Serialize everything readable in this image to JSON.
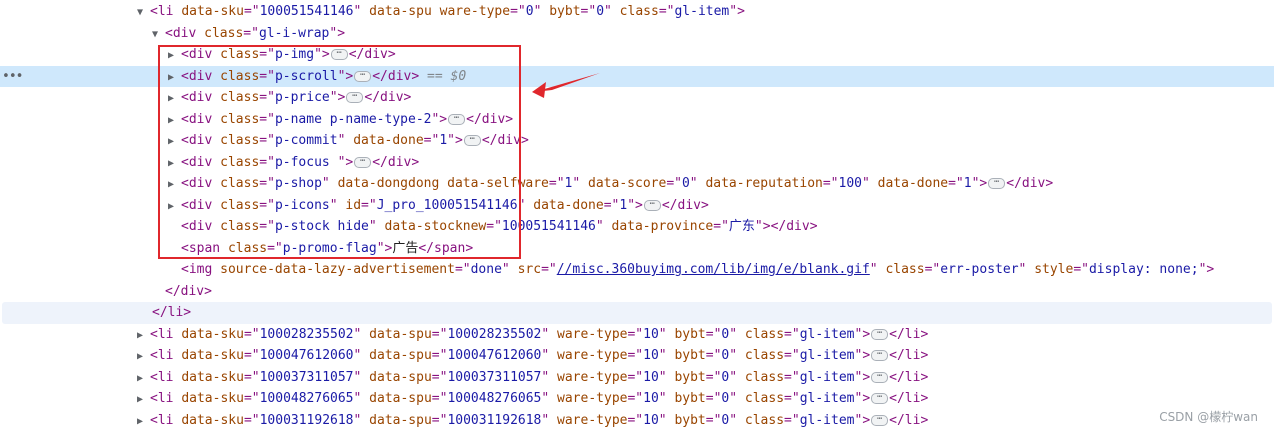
{
  "selected_marker": "== $0",
  "watermark": "CSDN @檬柠wan",
  "rows": [
    {
      "ind": 137,
      "tw": "▼",
      "p": [
        [
          "tag",
          "<li "
        ],
        [
          "an",
          "data-sku"
        ],
        [
          "tag",
          "=\""
        ],
        [
          "av",
          "100051541146"
        ],
        [
          "tag",
          "\" "
        ],
        [
          "an",
          "data-spu"
        ],
        [
          "tag",
          " "
        ],
        [
          "an",
          "ware-type"
        ],
        [
          "tag",
          "=\""
        ],
        [
          "av",
          "0"
        ],
        [
          "tag",
          "\" "
        ],
        [
          "an",
          "bybt"
        ],
        [
          "tag",
          "=\""
        ],
        [
          "av",
          "0"
        ],
        [
          "tag",
          "\" "
        ],
        [
          "an",
          "class"
        ],
        [
          "tag",
          "=\""
        ],
        [
          "av",
          "gl-item"
        ],
        [
          "tag",
          "\">"
        ]
      ]
    },
    {
      "ind": 152,
      "tw": "▼",
      "p": [
        [
          "tag",
          "<div "
        ],
        [
          "an",
          "class"
        ],
        [
          "tag",
          "=\""
        ],
        [
          "av",
          "gl-i-wrap"
        ],
        [
          "tag",
          "\">"
        ]
      ]
    },
    {
      "ind": 168,
      "tw": "▶",
      "p": [
        [
          "tag",
          "<div "
        ],
        [
          "an",
          "class"
        ],
        [
          "tag",
          "=\""
        ],
        [
          "av",
          "p-img"
        ],
        [
          "tag",
          "\">"
        ],
        [
          "ell",
          ""
        ],
        [
          "tag",
          "</div>"
        ]
      ]
    },
    {
      "ind": 168,
      "tw": "▶",
      "sel": true,
      "p": [
        [
          "tag",
          "<div "
        ],
        [
          "an",
          "class"
        ],
        [
          "tag",
          "=\""
        ],
        [
          "av",
          "p-scroll"
        ],
        [
          "tag",
          "\">"
        ],
        [
          "ell",
          ""
        ],
        [
          "tag",
          "</div>"
        ],
        [
          "dim",
          " == $0"
        ]
      ]
    },
    {
      "ind": 168,
      "tw": "▶",
      "p": [
        [
          "tag",
          "<div "
        ],
        [
          "an",
          "class"
        ],
        [
          "tag",
          "=\""
        ],
        [
          "av",
          "p-price"
        ],
        [
          "tag",
          "\">"
        ],
        [
          "ell",
          ""
        ],
        [
          "tag",
          "</div>"
        ]
      ]
    },
    {
      "ind": 168,
      "tw": "▶",
      "p": [
        [
          "tag",
          "<div "
        ],
        [
          "an",
          "class"
        ],
        [
          "tag",
          "=\""
        ],
        [
          "av",
          "p-name p-name-type-2"
        ],
        [
          "tag",
          "\">"
        ],
        [
          "ell",
          ""
        ],
        [
          "tag",
          "</div>"
        ]
      ]
    },
    {
      "ind": 168,
      "tw": "▶",
      "p": [
        [
          "tag",
          "<div "
        ],
        [
          "an",
          "class"
        ],
        [
          "tag",
          "=\""
        ],
        [
          "av",
          "p-commit"
        ],
        [
          "tag",
          "\" "
        ],
        [
          "an",
          "data-done"
        ],
        [
          "tag",
          "=\""
        ],
        [
          "av",
          "1"
        ],
        [
          "tag",
          "\">"
        ],
        [
          "ell",
          ""
        ],
        [
          "tag",
          "</div>"
        ]
      ]
    },
    {
      "ind": 168,
      "tw": "▶",
      "p": [
        [
          "tag",
          "<div "
        ],
        [
          "an",
          "class"
        ],
        [
          "tag",
          "=\""
        ],
        [
          "av",
          "p-focus  "
        ],
        [
          "tag",
          "\">"
        ],
        [
          "ell",
          ""
        ],
        [
          "tag",
          "</div>"
        ]
      ]
    },
    {
      "ind": 168,
      "tw": "▶",
      "p": [
        [
          "tag",
          "<div "
        ],
        [
          "an",
          "class"
        ],
        [
          "tag",
          "=\""
        ],
        [
          "av",
          "p-shop"
        ],
        [
          "tag",
          "\" "
        ],
        [
          "an",
          "data-dongdong"
        ],
        [
          "tag",
          " "
        ],
        [
          "an",
          "data-selfware"
        ],
        [
          "tag",
          "=\""
        ],
        [
          "av",
          "1"
        ],
        [
          "tag",
          "\" "
        ],
        [
          "an",
          "data-score"
        ],
        [
          "tag",
          "=\""
        ],
        [
          "av",
          "0"
        ],
        [
          "tag",
          "\" "
        ],
        [
          "an",
          "data-reputation"
        ],
        [
          "tag",
          "=\""
        ],
        [
          "av",
          "100"
        ],
        [
          "tag",
          "\" "
        ],
        [
          "an",
          "data-done"
        ],
        [
          "tag",
          "=\""
        ],
        [
          "av",
          "1"
        ],
        [
          "tag",
          "\">"
        ],
        [
          "ell",
          ""
        ],
        [
          "tag",
          "</div>"
        ]
      ]
    },
    {
      "ind": 168,
      "tw": "▶",
      "p": [
        [
          "tag",
          "<div "
        ],
        [
          "an",
          "class"
        ],
        [
          "tag",
          "=\""
        ],
        [
          "av",
          "p-icons"
        ],
        [
          "tag",
          "\" "
        ],
        [
          "an",
          "id"
        ],
        [
          "tag",
          "=\""
        ],
        [
          "av",
          "J_pro_100051541146"
        ],
        [
          "tag",
          "\" "
        ],
        [
          "an",
          "data-done"
        ],
        [
          "tag",
          "=\""
        ],
        [
          "av",
          "1"
        ],
        [
          "tag",
          "\">"
        ],
        [
          "ell",
          ""
        ],
        [
          "tag",
          "</div>"
        ]
      ]
    },
    {
      "ind": 168,
      "tw": "",
      "p": [
        [
          "tag",
          "<div "
        ],
        [
          "an",
          "class"
        ],
        [
          "tag",
          "=\""
        ],
        [
          "av",
          "p-stock hide"
        ],
        [
          "tag",
          "\" "
        ],
        [
          "an",
          "data-stocknew"
        ],
        [
          "tag",
          "=\""
        ],
        [
          "av",
          "100051541146"
        ],
        [
          "tag",
          "\" "
        ],
        [
          "an",
          "data-province"
        ],
        [
          "tag",
          "=\""
        ],
        [
          "av",
          "广东"
        ],
        [
          "tag",
          "\"></div>"
        ]
      ]
    },
    {
      "ind": 168,
      "tw": "",
      "p": [
        [
          "tag",
          "<span "
        ],
        [
          "an",
          "class"
        ],
        [
          "tag",
          "=\""
        ],
        [
          "av",
          "p-promo-flag"
        ],
        [
          "tag",
          "\">"
        ],
        [
          "tx",
          "广告"
        ],
        [
          "tag",
          "</span>"
        ]
      ]
    },
    {
      "ind": 168,
      "tw": "",
      "p": [
        [
          "tag",
          "<img "
        ],
        [
          "an",
          "source-data-lazy-advertisement"
        ],
        [
          "tag",
          "=\""
        ],
        [
          "av",
          "done"
        ],
        [
          "tag",
          "\" "
        ],
        [
          "an",
          "src"
        ],
        [
          "tag",
          "=\""
        ],
        [
          "link",
          "//misc.360buyimg.com/lib/img/e/blank.gif"
        ],
        [
          "tag",
          "\" "
        ],
        [
          "an",
          "class"
        ],
        [
          "tag",
          "=\""
        ],
        [
          "av",
          "err-poster"
        ],
        [
          "tag",
          "\" "
        ],
        [
          "an",
          "style"
        ],
        [
          "tag",
          "=\""
        ],
        [
          "av",
          "display: none;"
        ],
        [
          "tag",
          "\">"
        ]
      ]
    },
    {
      "ind": 152,
      "tw": "",
      "p": [
        [
          "tag",
          "</div>"
        ]
      ]
    },
    {
      "ind": 137,
      "tw": "",
      "hov": true,
      "p": [
        [
          "tag",
          "</li>"
        ]
      ]
    },
    {
      "ind": 137,
      "tw": "▶",
      "p": [
        [
          "tag",
          "<li "
        ],
        [
          "an",
          "data-sku"
        ],
        [
          "tag",
          "=\""
        ],
        [
          "av",
          "100028235502"
        ],
        [
          "tag",
          "\" "
        ],
        [
          "an",
          "data-spu"
        ],
        [
          "tag",
          "=\""
        ],
        [
          "av",
          "100028235502"
        ],
        [
          "tag",
          "\" "
        ],
        [
          "an",
          "ware-type"
        ],
        [
          "tag",
          "=\""
        ],
        [
          "av",
          "10"
        ],
        [
          "tag",
          "\" "
        ],
        [
          "an",
          "bybt"
        ],
        [
          "tag",
          "=\""
        ],
        [
          "av",
          "0"
        ],
        [
          "tag",
          "\" "
        ],
        [
          "an",
          "class"
        ],
        [
          "tag",
          "=\""
        ],
        [
          "av",
          "gl-item"
        ],
        [
          "tag",
          "\">"
        ],
        [
          "ell",
          ""
        ],
        [
          "tag",
          "</li>"
        ]
      ]
    },
    {
      "ind": 137,
      "tw": "▶",
      "p": [
        [
          "tag",
          "<li "
        ],
        [
          "an",
          "data-sku"
        ],
        [
          "tag",
          "=\""
        ],
        [
          "av",
          "100047612060"
        ],
        [
          "tag",
          "\" "
        ],
        [
          "an",
          "data-spu"
        ],
        [
          "tag",
          "=\""
        ],
        [
          "av",
          "100047612060"
        ],
        [
          "tag",
          "\" "
        ],
        [
          "an",
          "ware-type"
        ],
        [
          "tag",
          "=\""
        ],
        [
          "av",
          "10"
        ],
        [
          "tag",
          "\" "
        ],
        [
          "an",
          "bybt"
        ],
        [
          "tag",
          "=\""
        ],
        [
          "av",
          "0"
        ],
        [
          "tag",
          "\" "
        ],
        [
          "an",
          "class"
        ],
        [
          "tag",
          "=\""
        ],
        [
          "av",
          "gl-item"
        ],
        [
          "tag",
          "\">"
        ],
        [
          "ell",
          ""
        ],
        [
          "tag",
          "</li>"
        ]
      ]
    },
    {
      "ind": 137,
      "tw": "▶",
      "p": [
        [
          "tag",
          "<li "
        ],
        [
          "an",
          "data-sku"
        ],
        [
          "tag",
          "=\""
        ],
        [
          "av",
          "100037311057"
        ],
        [
          "tag",
          "\" "
        ],
        [
          "an",
          "data-spu"
        ],
        [
          "tag",
          "=\""
        ],
        [
          "av",
          "100037311057"
        ],
        [
          "tag",
          "\" "
        ],
        [
          "an",
          "ware-type"
        ],
        [
          "tag",
          "=\""
        ],
        [
          "av",
          "10"
        ],
        [
          "tag",
          "\" "
        ],
        [
          "an",
          "bybt"
        ],
        [
          "tag",
          "=\""
        ],
        [
          "av",
          "0"
        ],
        [
          "tag",
          "\" "
        ],
        [
          "an",
          "class"
        ],
        [
          "tag",
          "=\""
        ],
        [
          "av",
          "gl-item"
        ],
        [
          "tag",
          "\">"
        ],
        [
          "ell",
          ""
        ],
        [
          "tag",
          "</li>"
        ]
      ]
    },
    {
      "ind": 137,
      "tw": "▶",
      "p": [
        [
          "tag",
          "<li "
        ],
        [
          "an",
          "data-sku"
        ],
        [
          "tag",
          "=\""
        ],
        [
          "av",
          "100048276065"
        ],
        [
          "tag",
          "\" "
        ],
        [
          "an",
          "data-spu"
        ],
        [
          "tag",
          "=\""
        ],
        [
          "av",
          "100048276065"
        ],
        [
          "tag",
          "\" "
        ],
        [
          "an",
          "ware-type"
        ],
        [
          "tag",
          "=\""
        ],
        [
          "av",
          "10"
        ],
        [
          "tag",
          "\" "
        ],
        [
          "an",
          "bybt"
        ],
        [
          "tag",
          "=\""
        ],
        [
          "av",
          "0"
        ],
        [
          "tag",
          "\" "
        ],
        [
          "an",
          "class"
        ],
        [
          "tag",
          "=\""
        ],
        [
          "av",
          "gl-item"
        ],
        [
          "tag",
          "\">"
        ],
        [
          "ell",
          ""
        ],
        [
          "tag",
          "</li>"
        ]
      ]
    },
    {
      "ind": 137,
      "tw": "▶",
      "p": [
        [
          "tag",
          "<li "
        ],
        [
          "an",
          "data-sku"
        ],
        [
          "tag",
          "=\""
        ],
        [
          "av",
          "100031192618"
        ],
        [
          "tag",
          "\" "
        ],
        [
          "an",
          "data-spu"
        ],
        [
          "tag",
          "=\""
        ],
        [
          "av",
          "100031192618"
        ],
        [
          "tag",
          "\" "
        ],
        [
          "an",
          "ware-type"
        ],
        [
          "tag",
          "=\""
        ],
        [
          "av",
          "10"
        ],
        [
          "tag",
          "\" "
        ],
        [
          "an",
          "bybt"
        ],
        [
          "tag",
          "=\""
        ],
        [
          "av",
          "0"
        ],
        [
          "tag",
          "\" "
        ],
        [
          "an",
          "class"
        ],
        [
          "tag",
          "=\""
        ],
        [
          "av",
          "gl-item"
        ],
        [
          "tag",
          "\">"
        ],
        [
          "ell",
          ""
        ],
        [
          "tag",
          "</li>"
        ]
      ]
    }
  ],
  "annotation": {
    "box_color": "#e0272c",
    "arrow_color": "#e0272c"
  }
}
